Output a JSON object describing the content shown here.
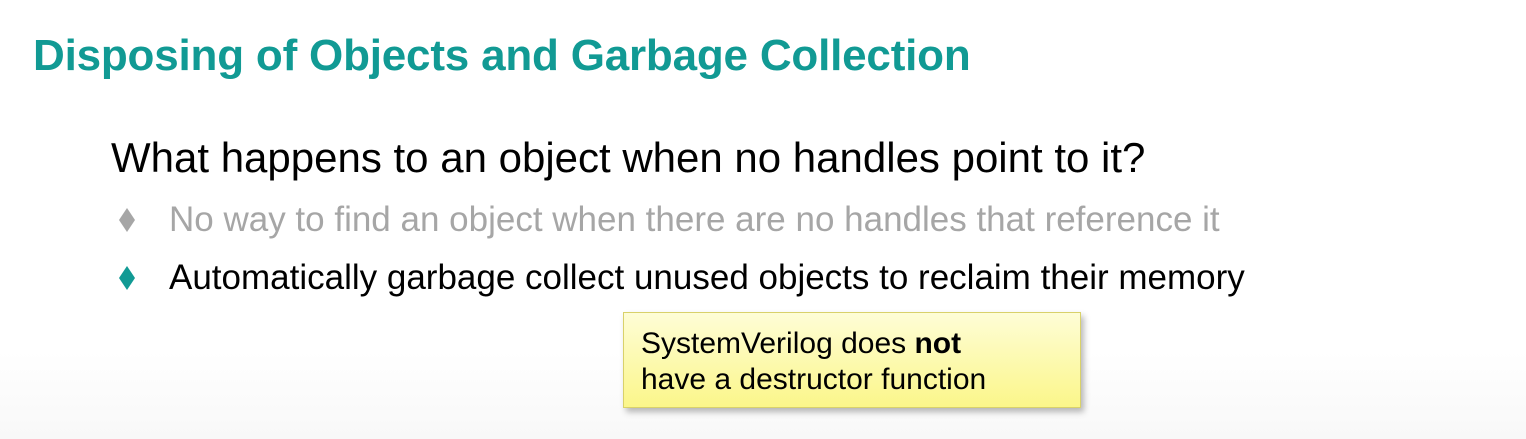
{
  "slide": {
    "title": "Disposing of Objects and Garbage Collection",
    "question": "What happens to an object when no handles point to it?",
    "bullets": [
      {
        "text": "No way to find an object when there are no handles that reference it",
        "state": "dimmed",
        "marker_icon": "diamond-icon"
      },
      {
        "text": "Automatically garbage collect unused objects to reclaim their memory",
        "state": "active",
        "marker_icon": "diamond-icon"
      }
    ],
    "callout": {
      "line1_prefix": "SystemVerilog does ",
      "line1_emphasis": "not",
      "line2": "have a destructor function"
    }
  },
  "colors": {
    "title": "#119a94",
    "question": "#000000",
    "bullet_dimmed_text": "#a6a6a6",
    "bullet_dimmed_marker": "#a6a6a6",
    "bullet_active_text": "#000000",
    "bullet_active_marker": "#119a94",
    "callout_bg": "#fcf9a8",
    "callout_border": "#d9d16a"
  }
}
